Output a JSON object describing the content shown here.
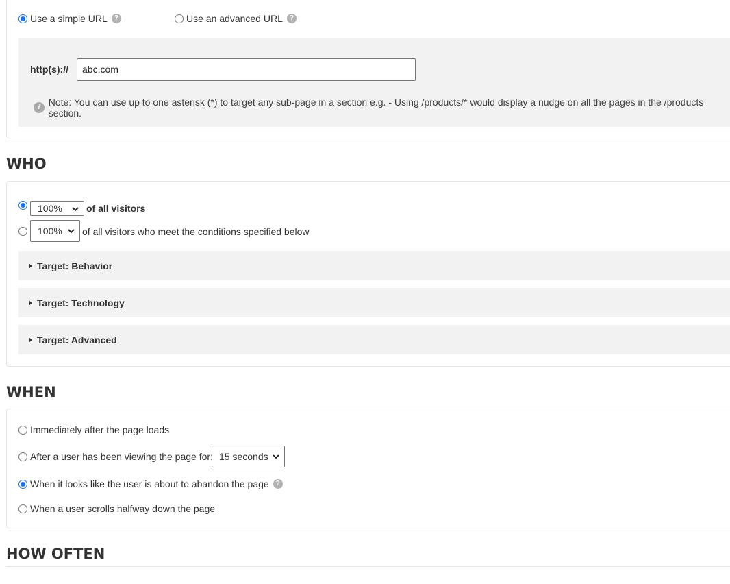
{
  "where": {
    "simple_url_label": "Use a simple URL",
    "advanced_url_label": "Use an advanced URL",
    "url_prefix": "http(s)://",
    "url_value": "abc.com",
    "note": "Note: You can use up to one asterisk (*) to target any sub-page in a section e.g. - Using /products/* would display a nudge on all the pages in the /products section."
  },
  "who": {
    "heading": "WHO",
    "option1_percent": "100%",
    "option1_label": "of all visitors",
    "option2_percent": "100%",
    "option2_label": "of all visitors who meet the conditions specified below",
    "accordions": [
      {
        "label": "Target: Behavior"
      },
      {
        "label": "Target: Technology"
      },
      {
        "label": "Target: Advanced"
      }
    ]
  },
  "when": {
    "heading": "WHEN",
    "options": [
      {
        "label": "Immediately after the page loads"
      },
      {
        "label": "After a user has been viewing the page for:"
      },
      {
        "label": "When it looks like the user is about to abandon the page"
      },
      {
        "label": "When a user scrolls halfway down the page"
      }
    ],
    "delay_value": "15 seconds"
  },
  "how_often": {
    "heading": "HOW OFTEN"
  },
  "icons": {
    "help_glyph": "?",
    "info_glyph": "i"
  }
}
